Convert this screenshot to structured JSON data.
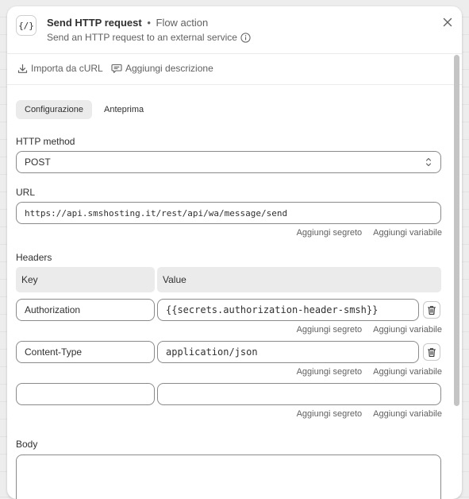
{
  "header": {
    "icon_text": "{/}",
    "title": "Send HTTP request",
    "separator": "•",
    "subtitle_tag": "Flow action",
    "description": "Send an HTTP request to an external service"
  },
  "toolbar": {
    "import_label": "Importa da cURL",
    "add_description_label": "Aggiungi descrizione"
  },
  "tabs": [
    {
      "label": "Configurazione",
      "active": true
    },
    {
      "label": "Anteprima",
      "active": false
    }
  ],
  "http_method": {
    "label": "HTTP method",
    "value": "POST"
  },
  "url": {
    "label": "URL",
    "value": "https://api.smshosting.it/rest/api/wa/message/send"
  },
  "helpers": {
    "add_secret": "Aggiungi segreto",
    "add_variable": "Aggiungi variabile"
  },
  "headers": {
    "label": "Headers",
    "key_column": "Key",
    "value_column": "Value",
    "rows": [
      {
        "key": "Authorization",
        "value": "{{secrets.authorization-header-smsh}}"
      },
      {
        "key": "Content-Type",
        "value": "application/json"
      },
      {
        "key": "",
        "value": ""
      }
    ]
  },
  "body": {
    "label": "Body",
    "value": ""
  },
  "colors": {
    "panel_bg": "#ffffff",
    "text": "#303030",
    "muted": "#616161",
    "border": "#8a8a8a",
    "tab_active_bg": "#ebebeb"
  }
}
